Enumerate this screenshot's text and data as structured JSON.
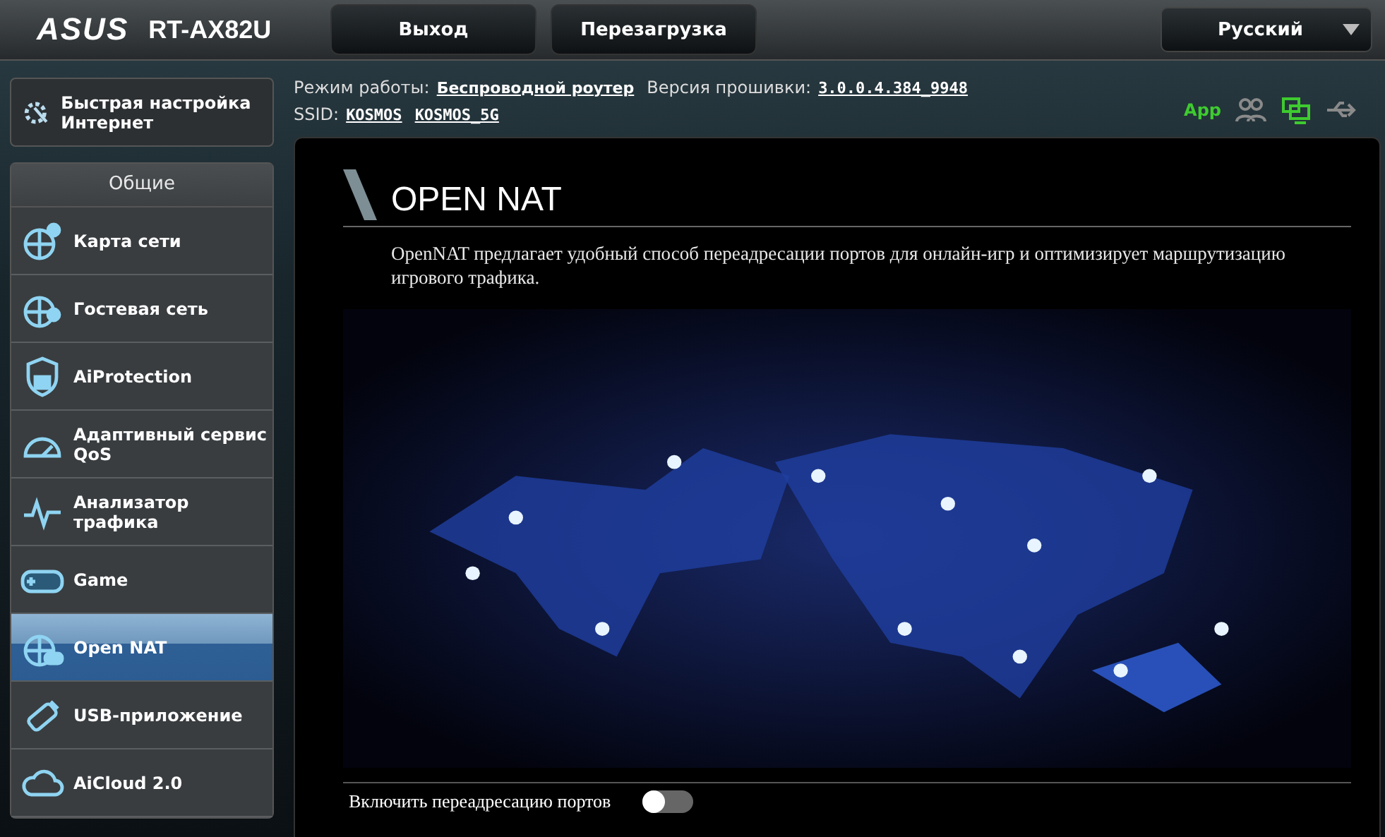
{
  "header": {
    "logo": "ASUS",
    "model": "RT-AX82U",
    "buttons": [
      "Выход",
      "Перезагрузка"
    ],
    "language": "Русский"
  },
  "info": {
    "mode_label": "Режим работы:",
    "mode_value": "Беспроводной роутер",
    "firmware_label": "Версия прошивки:",
    "firmware_value": "3.0.0.4.384_9948",
    "ssid_label": "SSID:",
    "ssids": [
      "KOSMOS",
      "KOSMOS_5G"
    ]
  },
  "status": {
    "app": "App",
    "icons": [
      {
        "kind": "clients",
        "on": false
      },
      {
        "kind": "network",
        "on": true
      },
      {
        "kind": "usb",
        "on": false
      }
    ]
  },
  "quick_setup": {
    "label": "Быстрая настройка Интернет"
  },
  "sidebar": {
    "section": "Общие",
    "items": [
      {
        "kind": "map",
        "label": "Карта сети",
        "selected": false
      },
      {
        "kind": "guest",
        "label": "Гостевая сеть",
        "selected": false
      },
      {
        "kind": "shield",
        "label": "AiProtection",
        "selected": false
      },
      {
        "kind": "gauge",
        "label": "Адаптивный сервис QoS",
        "selected": false
      },
      {
        "kind": "traffic",
        "label": "Анализатор трафика",
        "selected": false
      },
      {
        "kind": "game",
        "label": "Game",
        "selected": false
      },
      {
        "kind": "nat",
        "label": "Open NAT",
        "selected": true
      },
      {
        "kind": "usb",
        "label": "USB-приложение",
        "selected": false
      },
      {
        "kind": "cloud",
        "label": "AiCloud 2.0",
        "selected": false
      }
    ]
  },
  "page": {
    "title": "OPEN NAT",
    "description": "OpenNAT предлагает удобный способ переадресации портов для онлайн-игр и оптимизирует маршрутизацию игрового трафика.",
    "toggle": {
      "label": "Включить переадресацию портов",
      "on": false
    }
  }
}
